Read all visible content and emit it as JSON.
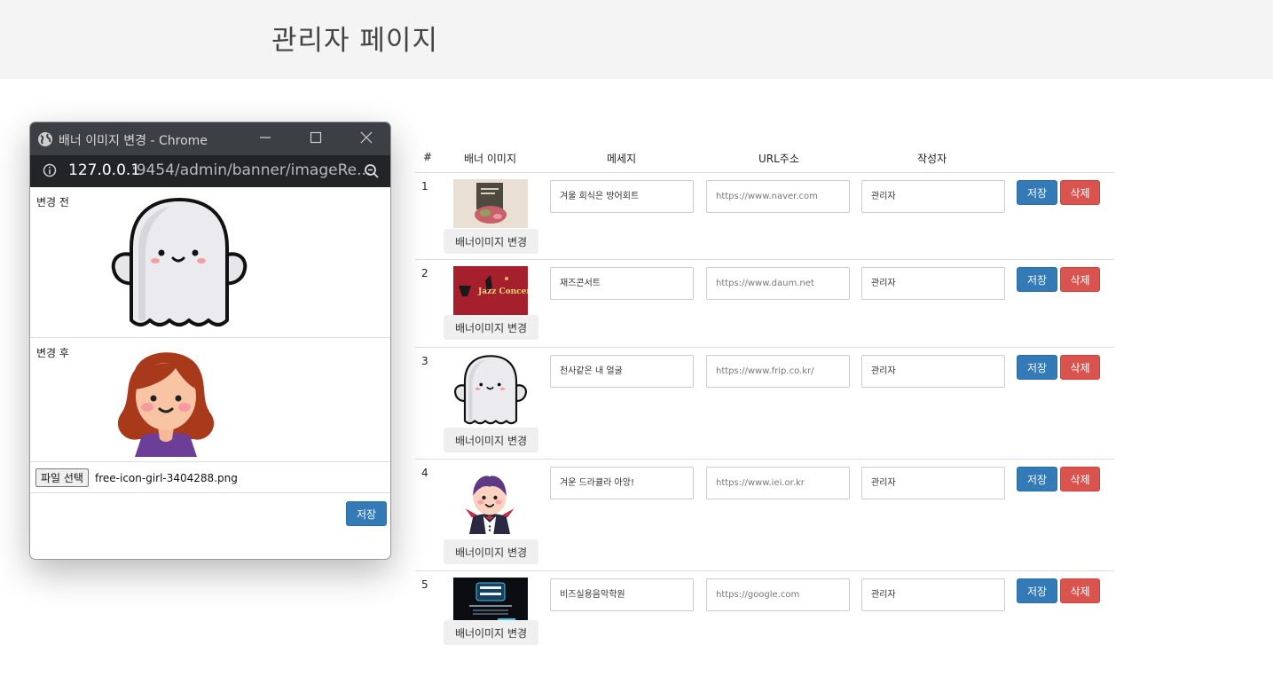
{
  "page": {
    "title": "관리자 페이지"
  },
  "table": {
    "headers": [
      "#",
      "배너 이미지",
      "메세지",
      "URL주소",
      "작성자"
    ],
    "change_image_label": "배너이미지 변경",
    "save_label": "저장",
    "delete_label": "삭제",
    "rows": [
      {
        "num": "1",
        "image": "seafood-photo",
        "message": "겨울 회식은 방어회트",
        "url": "https://www.naver.com",
        "writer": "관리자"
      },
      {
        "num": "2",
        "image": "jazz-concert-poster",
        "poster_text": "Jazz Concert",
        "message": "재즈콘서트",
        "url": "https://www.daum.net",
        "writer": "관리자"
      },
      {
        "num": "3",
        "image": "ghost-icon",
        "message": "천사같은 내 얼굴",
        "url": "https://www.frip.co.kr/",
        "writer": "관리자"
      },
      {
        "num": "4",
        "image": "vampire-icon",
        "message": "겨운 드라큘라 아앙!",
        "url": "https://www.iei.or.kr",
        "writer": "관리자"
      },
      {
        "num": "5",
        "image": "music-academy-banner",
        "message": "비즈실용음악학원",
        "url": "https://google.com",
        "writer": "관리자"
      }
    ]
  },
  "popup": {
    "window_title": "배너 이미지 변경 - Chrome",
    "url_host": "127.0.0.1",
    "url_rest": ":9454/admin/banner/imageRe...",
    "before_label": "변경 전",
    "after_label": "변경 후",
    "file_button": "파일 선택",
    "file_name": "free-icon-girl-3404288.png",
    "save_label": "저장"
  },
  "colors": {
    "primary": "#337ab7",
    "danger": "#d9534f",
    "header_bg": "#f4f4f4",
    "titlebar": "#3c3f43"
  }
}
